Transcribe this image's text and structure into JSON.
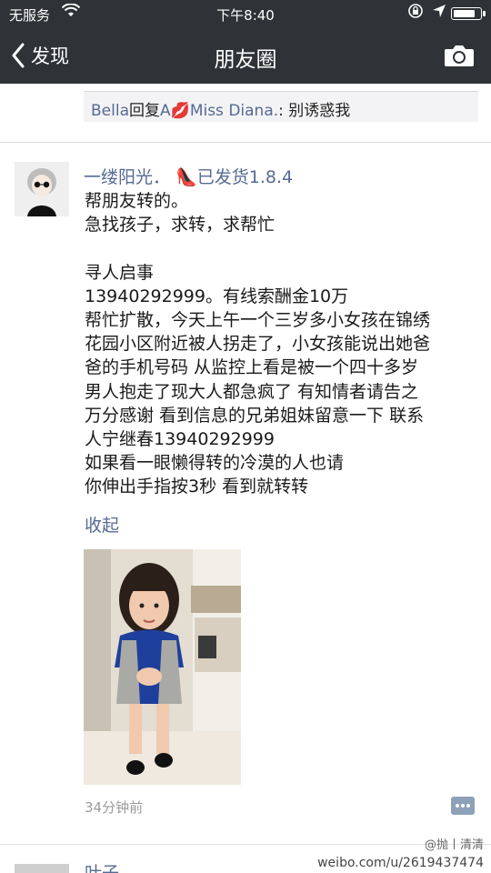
{
  "status_bar": {
    "carrier": "无服务",
    "wifi_icon": "wifi-icon",
    "time": "下午8:40",
    "lock_icon": "orientation-lock-icon",
    "location_icon": "location-arrow-icon",
    "battery_icon": "battery-icon",
    "battery_level": 0.85
  },
  "nav_bar": {
    "back_label": "发现",
    "title": "朋友圈",
    "camera_icon": "camera-icon"
  },
  "previous_comment": {
    "author": "Bella",
    "reply_word": "回复",
    "target_prefix": "A",
    "emoji_icon": "kiss-lips-icon",
    "target_name": "Miss Diana.",
    "text": ": 别诱惑我"
  },
  "post": {
    "author": "一缕阳光．",
    "emoji_icon": "high-heel-icon",
    "author_suffix": "已发货1.8.4",
    "lines": [
      "帮朋友转的。",
      "急找孩子，求转，求帮忙",
      "",
      "寻人启事",
      "13940292999。有线索酬金10万",
      "帮忙扩散，今天上午一个三岁多小女孩在锦绣",
      "花园小区附近被人拐走了，小女孩能说出她爸",
      "爸的手机号码 从监控上看是被一个四十多岁",
      "男人抱走了现大人都急疯了 有知情者请告之",
      "万分感谢 看到信息的兄弟姐妹留意一下 联系",
      "人宁继春13940292999",
      "如果看一眼懒得转的冷漠的人也请",
      "你伸出手指按3秒 看到就转转"
    ],
    "collapse_label": "收起",
    "photo_alt": "little-girl-photo",
    "timestamp": "34分钟前",
    "comment_icon": "comment-bubble-icon"
  },
  "next_post": {
    "author": "叶子"
  },
  "watermark": {
    "user": "@抛丨清清",
    "url": "weibo.com/u/2619437474"
  }
}
